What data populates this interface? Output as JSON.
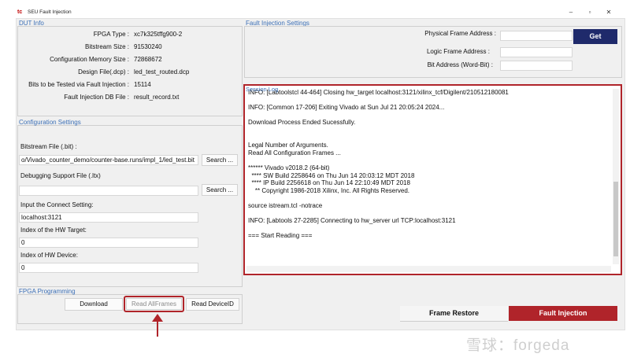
{
  "window": {
    "title": "SEU Fault Injection",
    "icon_text": "tc"
  },
  "dut_info": {
    "title": "DUT Info",
    "rows": [
      {
        "label": "FPGA Type :",
        "value": "xc7k325tffg900-2"
      },
      {
        "label": "Bitstream Size :",
        "value": "91530240"
      },
      {
        "label": "Configuration Memory Size :",
        "value": "72868672"
      },
      {
        "label": "Design File(.dcp) :",
        "value": "led_test_routed.dcp"
      },
      {
        "label": "Bits to be Tested via Fault Injection :",
        "value": "15114"
      },
      {
        "label": "Fault Injection DB File :",
        "value": "result_record.txt"
      }
    ]
  },
  "config": {
    "title": "Configuration Settings",
    "bitstream_label": "Bitstream File (.bit) :",
    "bitstream_value": "o/Vivado_counter_demo/counter-base.runs/impl_1/led_test.bit",
    "search_label": "Search ...",
    "debug_label": "Debugging Support File (.ltx)",
    "debug_value": "",
    "connect_label": "Input the Connect Setting:",
    "connect_value": "localhost:3121",
    "hw_target_label": "Index of the HW Target:",
    "hw_target_value": "0",
    "hw_device_label": "Index of HW Device:",
    "hw_device_value": "0"
  },
  "programming": {
    "title": "FPGA Programming",
    "download_label": "Download",
    "read_all_label": "Read AllFrames",
    "read_device_label": "Read DeviceID"
  },
  "fault_settings": {
    "title": "Fault Injection Settings",
    "physical_label": "Physical Frame Address :",
    "physical_value": "",
    "logic_label": "Logic Frame Address :",
    "logic_value": "",
    "bit_label": "Bit Address (Word-Bit) :",
    "bit_value": "",
    "get_label": "Get"
  },
  "session_log": {
    "title": "Session Log",
    "lines": [
      "INFO: [Labtoolstcl 44-464] Closing hw_target localhost:3121/xilinx_tcf/Digilent/210512180081",
      "",
      "INFO: [Common 17-206] Exiting Vivado at Sun Jul 21 20:05:24 2024...",
      "",
      "Download Process Ended Sucessfully.",
      "",
      "",
      "Legal Number of Arguments.",
      "Read All Configuration Frames ...",
      "",
      "****** Vivado v2018.2 (64-bit)",
      "  **** SW Build 2258646 on Thu Jun 14 20:03:12 MDT 2018",
      "  **** IP Build 2256618 on Thu Jun 14 22:10:49 MDT 2018",
      "    ** Copyright 1986-2018 Xilinx, Inc. All Rights Reserved.",
      "",
      "source istream.tcl -notrace",
      "",
      "INFO: [Labtools 27-2285] Connecting to hw_server url TCP:localhost:3121",
      "",
      "=== Start Reading ==="
    ]
  },
  "tabs": {
    "frame_restore": "Frame Restore",
    "fault_injection": "Fault Injection"
  },
  "watermark": "雪球：forgeda",
  "colors": {
    "accent_red": "#b0242a",
    "get_button": "#1f2a6b",
    "fault_tab": "#b0242a",
    "group_title": "#3b6fb6"
  }
}
